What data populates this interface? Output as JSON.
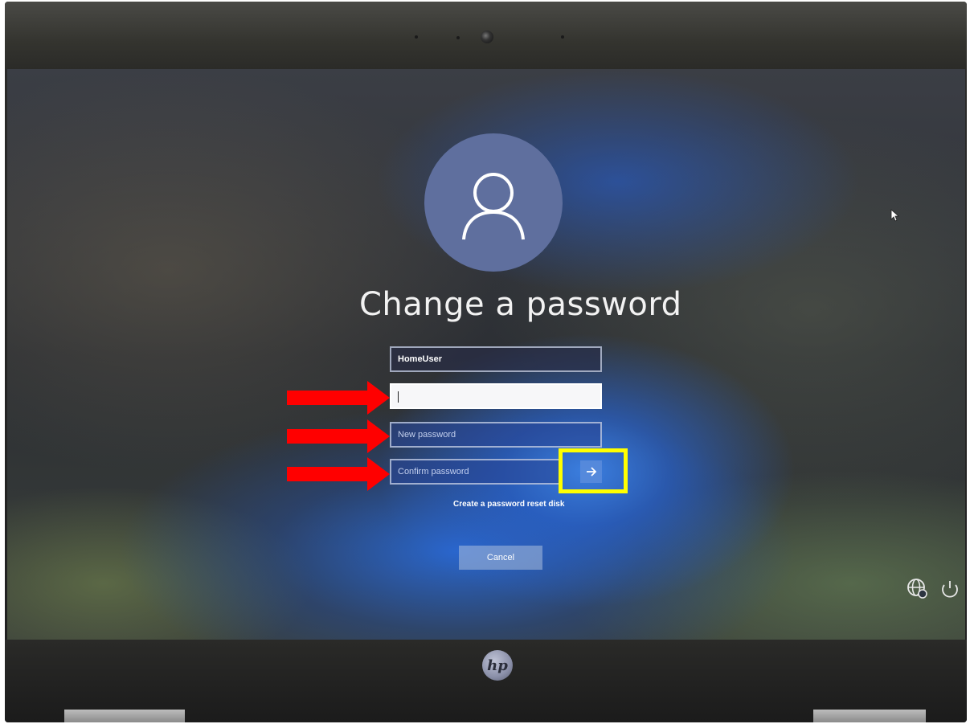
{
  "dialog": {
    "title": "Change a password",
    "username": "HomeUser",
    "old_password_value": "",
    "new_password_placeholder": "New password",
    "confirm_password_placeholder": "Confirm password",
    "submit_icon": "arrow-right-icon",
    "reset_disk_link": "Create a password reset disk",
    "cancel_label": "Cancel"
  },
  "system_icons": [
    "network-icon",
    "power-icon"
  ],
  "annotations": {
    "arrow_color": "#ff0000",
    "highlight_color": "#ffff00"
  },
  "device": {
    "brand_logo": "hp"
  }
}
